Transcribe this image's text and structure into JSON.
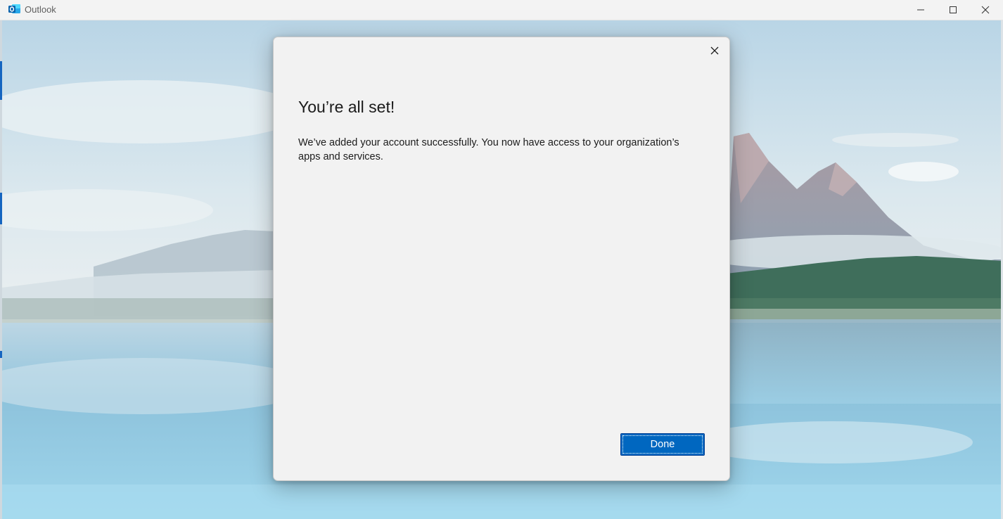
{
  "window": {
    "title": "Outlook",
    "app_icon": "outlook-icon",
    "controls": {
      "minimize_icon": "minimize-icon",
      "maximize_icon": "maximize-icon",
      "close_icon": "close-icon"
    }
  },
  "dialog": {
    "title": "You’re all set!",
    "message": "We’ve added your account successfully. You now have access to your organization’s apps and services.",
    "done_label": "Done",
    "close_icon": "close-icon"
  },
  "colors": {
    "accent": "#0067c0",
    "dialog_background": "#f2f2f2",
    "titlebar": "#f3f3f3"
  }
}
